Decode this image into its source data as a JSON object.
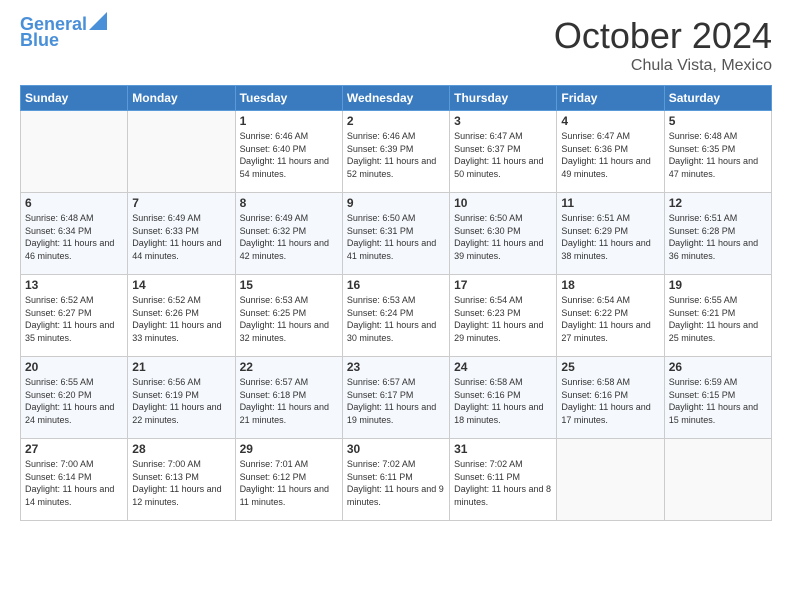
{
  "logo": {
    "line1": "General",
    "line2": "Blue"
  },
  "title": "October 2024",
  "location": "Chula Vista, Mexico",
  "days_header": [
    "Sunday",
    "Monday",
    "Tuesday",
    "Wednesday",
    "Thursday",
    "Friday",
    "Saturday"
  ],
  "weeks": [
    [
      {
        "day": "",
        "info": ""
      },
      {
        "day": "",
        "info": ""
      },
      {
        "day": "1",
        "info": "Sunrise: 6:46 AM\nSunset: 6:40 PM\nDaylight: 11 hours and 54 minutes."
      },
      {
        "day": "2",
        "info": "Sunrise: 6:46 AM\nSunset: 6:39 PM\nDaylight: 11 hours and 52 minutes."
      },
      {
        "day": "3",
        "info": "Sunrise: 6:47 AM\nSunset: 6:37 PM\nDaylight: 11 hours and 50 minutes."
      },
      {
        "day": "4",
        "info": "Sunrise: 6:47 AM\nSunset: 6:36 PM\nDaylight: 11 hours and 49 minutes."
      },
      {
        "day": "5",
        "info": "Sunrise: 6:48 AM\nSunset: 6:35 PM\nDaylight: 11 hours and 47 minutes."
      }
    ],
    [
      {
        "day": "6",
        "info": "Sunrise: 6:48 AM\nSunset: 6:34 PM\nDaylight: 11 hours and 46 minutes."
      },
      {
        "day": "7",
        "info": "Sunrise: 6:49 AM\nSunset: 6:33 PM\nDaylight: 11 hours and 44 minutes."
      },
      {
        "day": "8",
        "info": "Sunrise: 6:49 AM\nSunset: 6:32 PM\nDaylight: 11 hours and 42 minutes."
      },
      {
        "day": "9",
        "info": "Sunrise: 6:50 AM\nSunset: 6:31 PM\nDaylight: 11 hours and 41 minutes."
      },
      {
        "day": "10",
        "info": "Sunrise: 6:50 AM\nSunset: 6:30 PM\nDaylight: 11 hours and 39 minutes."
      },
      {
        "day": "11",
        "info": "Sunrise: 6:51 AM\nSunset: 6:29 PM\nDaylight: 11 hours and 38 minutes."
      },
      {
        "day": "12",
        "info": "Sunrise: 6:51 AM\nSunset: 6:28 PM\nDaylight: 11 hours and 36 minutes."
      }
    ],
    [
      {
        "day": "13",
        "info": "Sunrise: 6:52 AM\nSunset: 6:27 PM\nDaylight: 11 hours and 35 minutes."
      },
      {
        "day": "14",
        "info": "Sunrise: 6:52 AM\nSunset: 6:26 PM\nDaylight: 11 hours and 33 minutes."
      },
      {
        "day": "15",
        "info": "Sunrise: 6:53 AM\nSunset: 6:25 PM\nDaylight: 11 hours and 32 minutes."
      },
      {
        "day": "16",
        "info": "Sunrise: 6:53 AM\nSunset: 6:24 PM\nDaylight: 11 hours and 30 minutes."
      },
      {
        "day": "17",
        "info": "Sunrise: 6:54 AM\nSunset: 6:23 PM\nDaylight: 11 hours and 29 minutes."
      },
      {
        "day": "18",
        "info": "Sunrise: 6:54 AM\nSunset: 6:22 PM\nDaylight: 11 hours and 27 minutes."
      },
      {
        "day": "19",
        "info": "Sunrise: 6:55 AM\nSunset: 6:21 PM\nDaylight: 11 hours and 25 minutes."
      }
    ],
    [
      {
        "day": "20",
        "info": "Sunrise: 6:55 AM\nSunset: 6:20 PM\nDaylight: 11 hours and 24 minutes."
      },
      {
        "day": "21",
        "info": "Sunrise: 6:56 AM\nSunset: 6:19 PM\nDaylight: 11 hours and 22 minutes."
      },
      {
        "day": "22",
        "info": "Sunrise: 6:57 AM\nSunset: 6:18 PM\nDaylight: 11 hours and 21 minutes."
      },
      {
        "day": "23",
        "info": "Sunrise: 6:57 AM\nSunset: 6:17 PM\nDaylight: 11 hours and 19 minutes."
      },
      {
        "day": "24",
        "info": "Sunrise: 6:58 AM\nSunset: 6:16 PM\nDaylight: 11 hours and 18 minutes."
      },
      {
        "day": "25",
        "info": "Sunrise: 6:58 AM\nSunset: 6:16 PM\nDaylight: 11 hours and 17 minutes."
      },
      {
        "day": "26",
        "info": "Sunrise: 6:59 AM\nSunset: 6:15 PM\nDaylight: 11 hours and 15 minutes."
      }
    ],
    [
      {
        "day": "27",
        "info": "Sunrise: 7:00 AM\nSunset: 6:14 PM\nDaylight: 11 hours and 14 minutes."
      },
      {
        "day": "28",
        "info": "Sunrise: 7:00 AM\nSunset: 6:13 PM\nDaylight: 11 hours and 12 minutes."
      },
      {
        "day": "29",
        "info": "Sunrise: 7:01 AM\nSunset: 6:12 PM\nDaylight: 11 hours and 11 minutes."
      },
      {
        "day": "30",
        "info": "Sunrise: 7:02 AM\nSunset: 6:11 PM\nDaylight: 11 hours and 9 minutes."
      },
      {
        "day": "31",
        "info": "Sunrise: 7:02 AM\nSunset: 6:11 PM\nDaylight: 11 hours and 8 minutes."
      },
      {
        "day": "",
        "info": ""
      },
      {
        "day": "",
        "info": ""
      }
    ]
  ]
}
